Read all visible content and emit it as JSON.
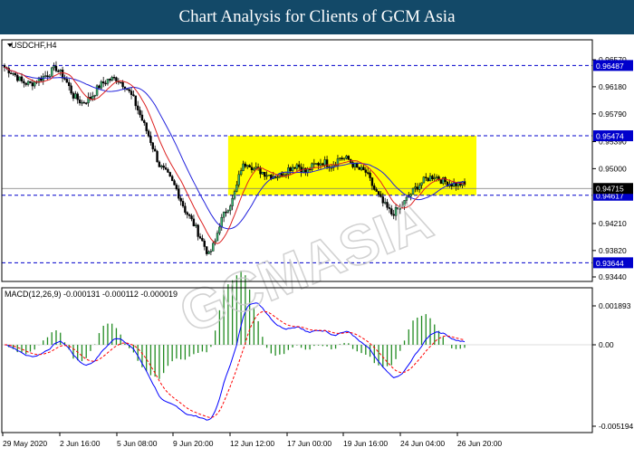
{
  "banner": {
    "title": "Chart Analysis for Clients of GCM Asia"
  },
  "chart_data": [
    {
      "type": "candlestick",
      "title": "USDCHF,H4",
      "ylim": [
        0.9344,
        0.9657
      ],
      "y_ticks": [
        "0.96570",
        "0.96180",
        "0.95790",
        "0.95390",
        "0.95000",
        "0.94210",
        "0.93820",
        "0.93440"
      ],
      "x_ticks": [
        "29 May 2020",
        "2 Jun 16:00",
        "5 Jun 08:00",
        "9 Jun 20:00",
        "12 Jun 12:00",
        "17 Jun 00:00",
        "19 Jun 16:00",
        "24 Jun 04:00",
        "26 Jun 20:00"
      ],
      "levels": [
        {
          "value": 0.96487,
          "label": "0.96487",
          "style": "dashed",
          "color": "#0000cc"
        },
        {
          "value": 0.95474,
          "label": "0.95474",
          "style": "dashed",
          "color": "#0000cc"
        },
        {
          "value": 0.94617,
          "label": "0.94617",
          "style": "dashed",
          "color": "#0000cc"
        },
        {
          "value": 0.93644,
          "label": "0.93644",
          "style": "dashed",
          "color": "#0000cc"
        }
      ],
      "current_price": {
        "value": 0.94715,
        "label": "0.94715"
      },
      "highlight_zone": {
        "from": 0.94617,
        "to": 0.95474,
        "color": "#ffff00"
      },
      "moving_averages": [
        {
          "color": "#2222dd"
        },
        {
          "color": "#dd2222"
        }
      ]
    },
    {
      "type": "macd",
      "title": "MACD(12,26,9) -0.000131 -0.000112 -0.000019",
      "ylim": [
        -0.005194,
        0.001893
      ],
      "y_ticks": [
        "0.001893",
        "0.00",
        "-0.005194"
      ],
      "colors": {
        "histogram": "#228b22",
        "macd_line": "#0000ff",
        "signal_line": "#ff0000"
      }
    }
  ],
  "watermark": {
    "text": "GCMASIA"
  }
}
